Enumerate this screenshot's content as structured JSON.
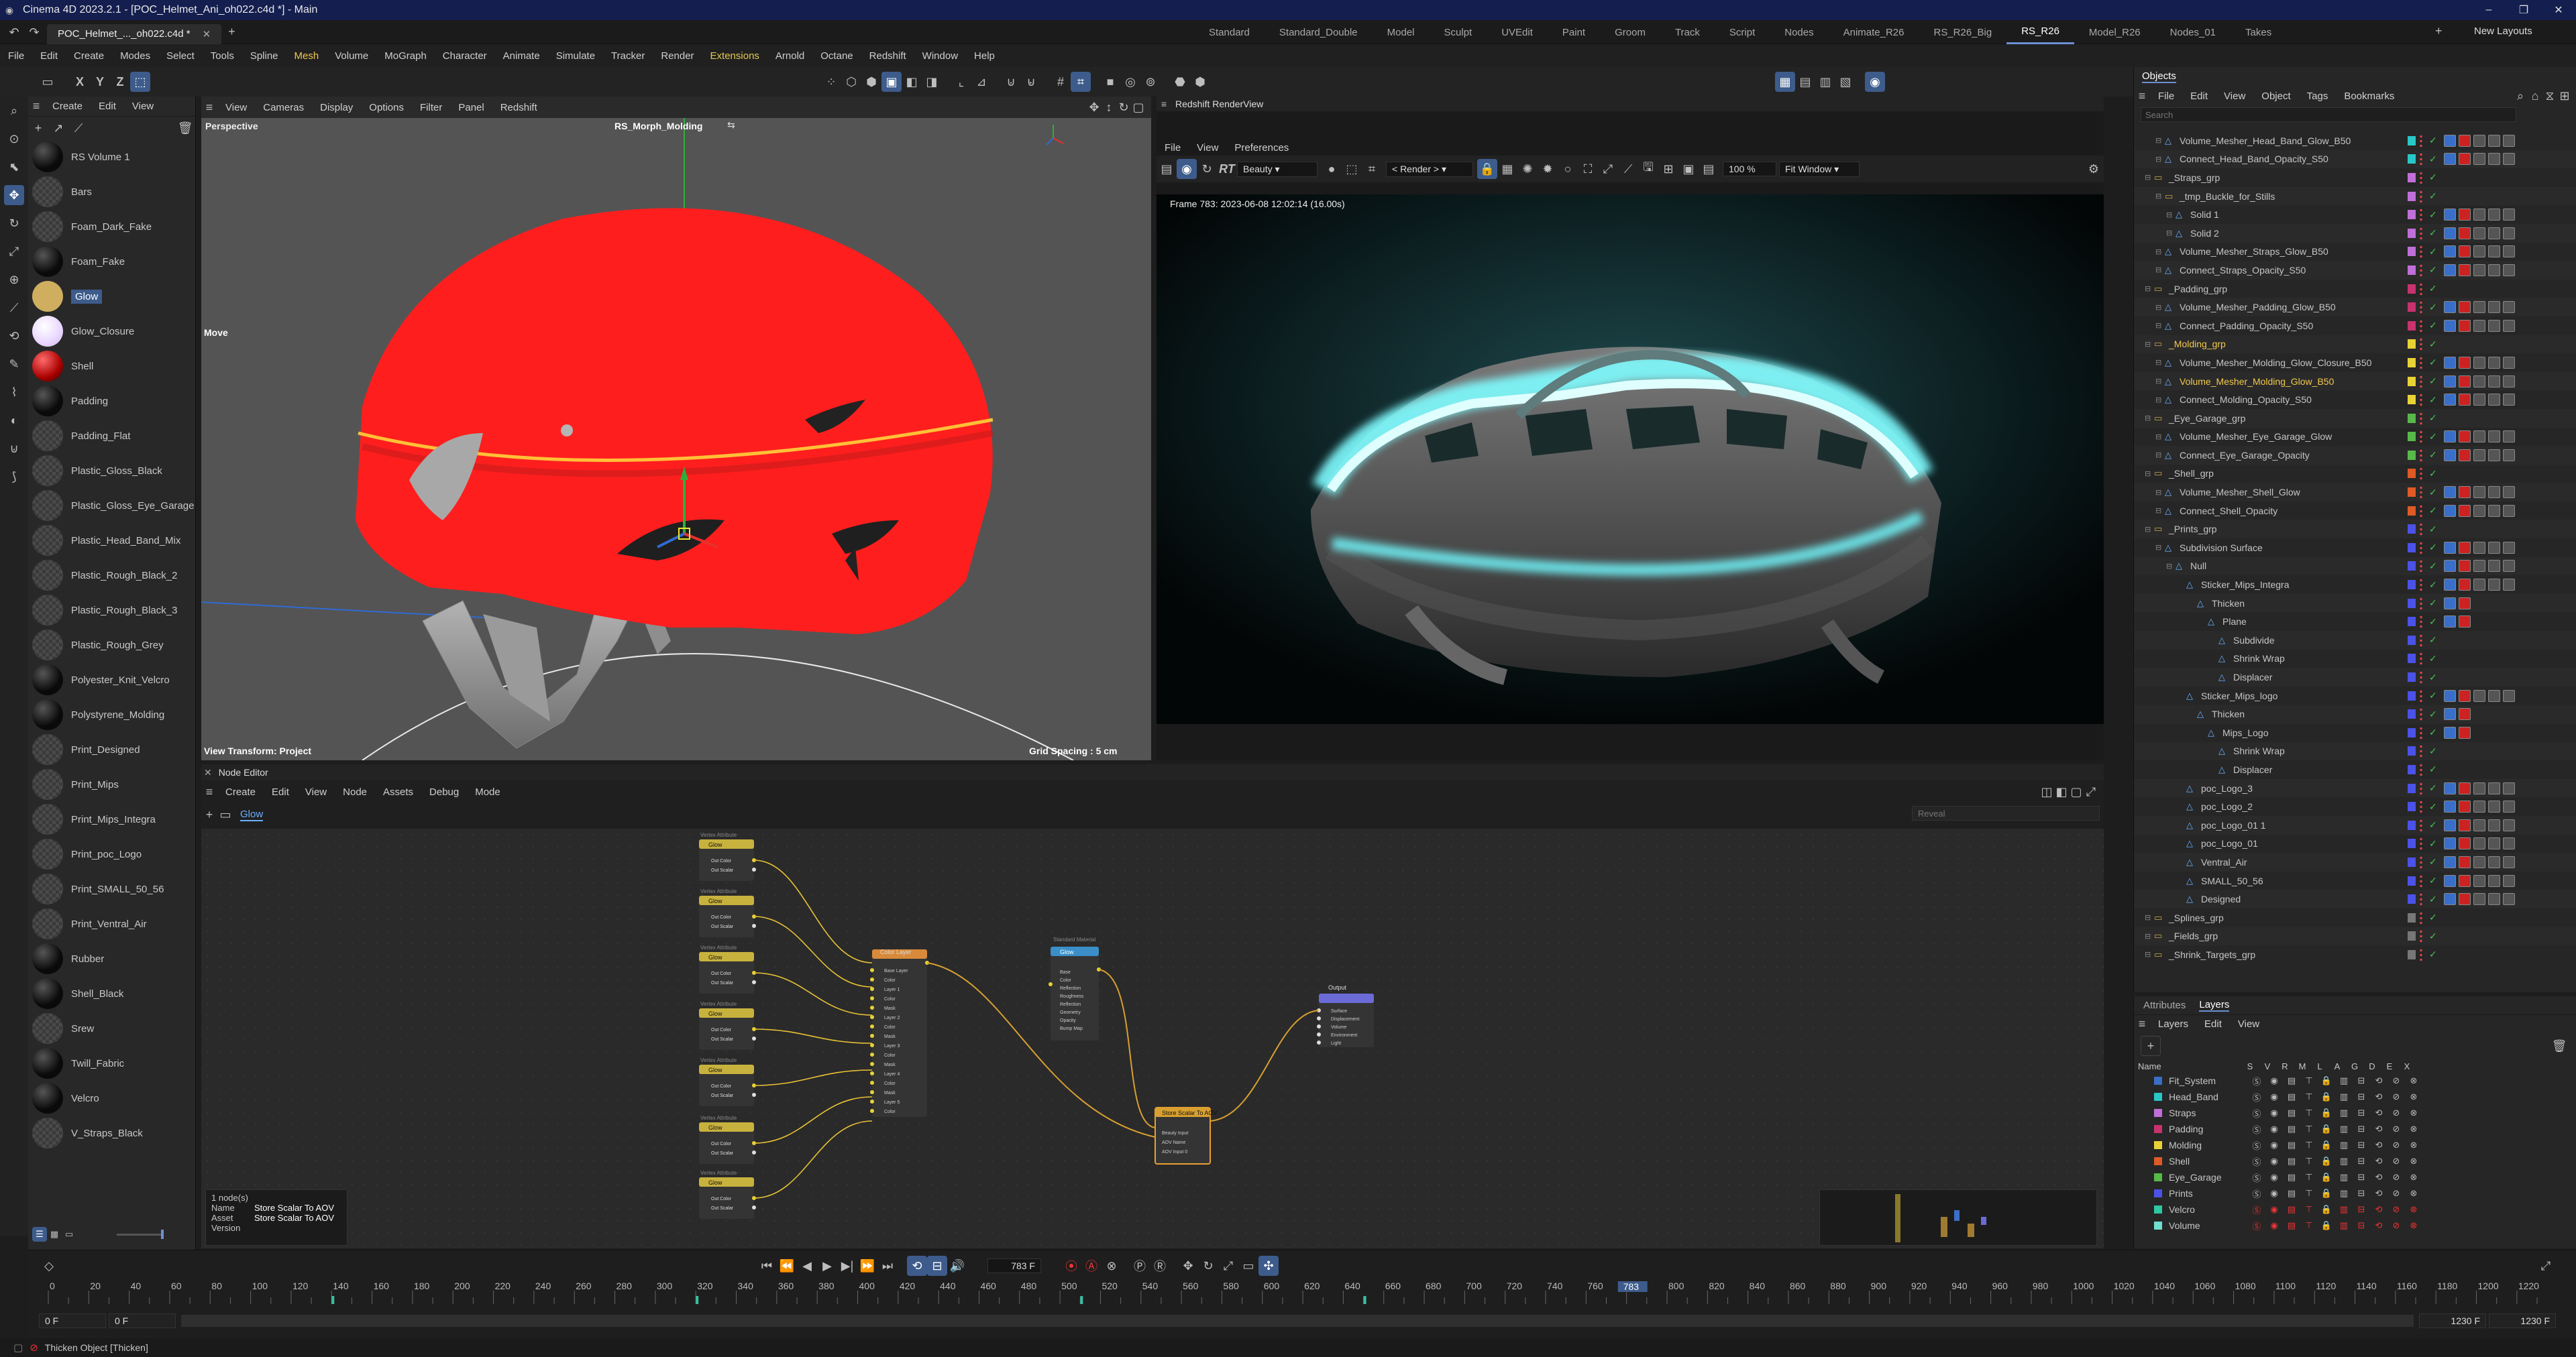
{
  "app": {
    "title": "Cinema 4D 2023.2.1 - [POC_Helmet_Ani_oh022.c4d *] - Main",
    "doc_tab": "POC_Helmet_..._oh022.c4d *",
    "new_tab": "+"
  },
  "window": {
    "min": "–",
    "max": "❐",
    "close": "✕"
  },
  "layouts": [
    "Standard",
    "Standard_Double",
    "Model",
    "Sculpt",
    "UVEdit",
    "Paint",
    "Groom",
    "Track",
    "Script",
    "Nodes",
    "Animate_R26",
    "RS_R26_Big",
    "RS_R26",
    "Model_R26",
    "Nodes_01",
    "Takes"
  ],
  "layouts_active": "RS_R26",
  "layouts_plus": "+",
  "new_layouts": "New Layouts",
  "menu": [
    "File",
    "Edit",
    "Create",
    "Modes",
    "Select",
    "Tools",
    "Spline",
    "Mesh",
    "Volume",
    "MoGraph",
    "Character",
    "Animate",
    "Simulate",
    "Tracker",
    "Render",
    "Extensions",
    "Arnold",
    "Octane",
    "Redshift",
    "Window",
    "Help"
  ],
  "toolbar": {
    "axes": [
      "X",
      "Y",
      "Z"
    ]
  },
  "materials": {
    "menu": [
      "Create",
      "Edit",
      "View"
    ],
    "items": [
      "RS Volume 1",
      "Bars",
      "Foam_Dark_Fake",
      "Foam_Fake",
      "Glow",
      "Glow_Closure",
      "Shell",
      "Padding",
      "Padding_Flat",
      "Plastic_Gloss_Black",
      "Plastic_Gloss_Eye_Garage",
      "Plastic_Head_Band_Mix",
      "Plastic_Rough_Black_2",
      "Plastic_Rough_Black_3",
      "Plastic_Rough_Grey",
      "Polyester_Knit_Velcro",
      "Polystyrene_Molding",
      "Print_Designed",
      "Print_Mips",
      "Print_Mips_Integra",
      "Print_poc_Logo",
      "Print_SMALL_50_56",
      "Print_Ventral_Air",
      "Rubber",
      "Shell_Black",
      "Srew",
      "Twill_Fabric",
      "Velcro",
      "V_Straps_Black"
    ],
    "selected": "Glow"
  },
  "viewport": {
    "menu": [
      "View",
      "Cameras",
      "Display",
      "Options",
      "Filter",
      "Panel",
      "Redshift"
    ],
    "name": "Perspective",
    "camera": "RS_Morph_Molding",
    "move": "Move",
    "view_transform": "View Transform: Project",
    "grid": "Grid Spacing : 5 cm"
  },
  "render": {
    "title": "Redshift RenderView",
    "menu": [
      "File",
      "View",
      "Preferences"
    ],
    "aov": "Beauty",
    "target": "< Render >",
    "zoom": "100 %",
    "fit": "Fit Window",
    "frame_info": "Frame  783:  2023-06-08  12:02:14  (16.00s)"
  },
  "node_editor": {
    "title": "Node Editor",
    "menu": [
      "Create",
      "Edit",
      "View",
      "Node",
      "Assets",
      "Debug",
      "Mode"
    ],
    "tab": "Glow",
    "search_placeholder": "Reveal",
    "nodes": {
      "vertex_title": "Vertex Attribute",
      "vertex_name": "Glow",
      "vertex_out": [
        "Out Color",
        "Out Scalar"
      ],
      "color_layer": "Color Layer",
      "color_layer_ports": [
        "Base Layer",
        "Color",
        "Layer 1",
        "Color",
        "Mask",
        "Layer 2",
        "Color",
        "Mask",
        "Layer 3",
        "Color",
        "Mask",
        "Layer 4",
        "Color",
        "Mask",
        "Layer 5",
        "Color"
      ],
      "std_mat_head": "Standard Material",
      "std_mat": "Glow",
      "std_ports": [
        "Base",
        "Color",
        "Reflection",
        "Roughness",
        "Reflection",
        "Geometry",
        "Opacity",
        "Bump Map"
      ],
      "store": "Store Scalar To AOV",
      "store_ports": [
        "Beauty Input",
        "AOV Name",
        "AOV Input 0"
      ],
      "output": "Output",
      "output_ports": [
        "Surface",
        "Displacement",
        "Volume",
        "Environment",
        "Light"
      ]
    },
    "info": {
      "count": "1 node(s)",
      "name_label": "Name",
      "name_value": "Store Scalar To AOV",
      "asset_label": "Asset",
      "asset_value": "Store Scalar To AOV",
      "version_label": "Version"
    }
  },
  "objects": {
    "tab": "Objects",
    "menu": [
      "File",
      "Edit",
      "View",
      "Object",
      "Tags",
      "Bookmarks"
    ],
    "search_placeholder": "Search",
    "items": [
      {
        "name": "Volume_Mesher_Head_Band_Glow_B50",
        "indent": 2,
        "color": "#29c7c7"
      },
      {
        "name": "Connect_Head_Band_Opacity_S50",
        "indent": 2,
        "color": "#29c7c7"
      },
      {
        "name": "_Straps_grp",
        "indent": 1,
        "color": "#c06fd8"
      },
      {
        "name": "_tmp_Buckle_for_Stills",
        "indent": 2,
        "color": "#c06fd8"
      },
      {
        "name": "Solid 1",
        "indent": 3,
        "color": "#c06fd8"
      },
      {
        "name": "Solid 2",
        "indent": 3,
        "color": "#c06fd8"
      },
      {
        "name": "Volume_Mesher_Straps_Glow_B50",
        "indent": 2,
        "color": "#c06fd8"
      },
      {
        "name": "Connect_Straps_Opacity_S50",
        "indent": 2,
        "color": "#c06fd8"
      },
      {
        "name": "_Padding_grp",
        "indent": 1,
        "color": "#c8326e"
      },
      {
        "name": "Volume_Mesher_Padding_Glow_B50",
        "indent": 2,
        "color": "#c8326e"
      },
      {
        "name": "Connect_Padding_Opacity_S50",
        "indent": 2,
        "color": "#c8326e"
      },
      {
        "name": "_Molding_grp",
        "indent": 1,
        "color": "#e8d235",
        "hl": true
      },
      {
        "name": "Volume_Mesher_Molding_Glow_Closure_B50",
        "indent": 2,
        "color": "#e8d235"
      },
      {
        "name": "Volume_Mesher_Molding_Glow_B50",
        "indent": 2,
        "color": "#e8d235",
        "hl": true
      },
      {
        "name": "Connect_Molding_Opacity_S50",
        "indent": 2,
        "color": "#e8d235"
      },
      {
        "name": "_Eye_Garage_grp",
        "indent": 1,
        "color": "#58b84a"
      },
      {
        "name": "Volume_Mesher_Eye_Garage_Glow",
        "indent": 2,
        "color": "#58b84a"
      },
      {
        "name": "Connect_Eye_Garage_Opacity",
        "indent": 2,
        "color": "#58b84a"
      },
      {
        "name": "_Shell_grp",
        "indent": 1,
        "color": "#e05a25"
      },
      {
        "name": "Volume_Mesher_Shell_Glow",
        "indent": 2,
        "color": "#e05a25"
      },
      {
        "name": "Connect_Shell_Opacity",
        "indent": 2,
        "color": "#e05a25"
      },
      {
        "name": "_Prints_grp",
        "indent": 1,
        "color": "#4b52e8"
      },
      {
        "name": "Subdivision Surface",
        "indent": 2,
        "color": "#4b52e8"
      },
      {
        "name": "Null",
        "indent": 3,
        "color": "#4b52e8"
      },
      {
        "name": "Sticker_Mips_Integra",
        "indent": 4,
        "color": "#4b52e8"
      },
      {
        "name": "Thicken",
        "indent": 5,
        "color": "#4b52e8"
      },
      {
        "name": "Plane",
        "indent": 6,
        "color": "#4b52e8"
      },
      {
        "name": "Subdivide",
        "indent": 7,
        "color": "#4b52e8"
      },
      {
        "name": "Shrink Wrap",
        "indent": 7,
        "color": "#4b52e8"
      },
      {
        "name": "Displacer",
        "indent": 7,
        "color": "#4b52e8"
      },
      {
        "name": "Sticker_Mips_logo",
        "indent": 4,
        "color": "#4b52e8"
      },
      {
        "name": "Thicken",
        "indent": 5,
        "color": "#4b52e8"
      },
      {
        "name": "Mips_Logo",
        "indent": 6,
        "color": "#4b52e8"
      },
      {
        "name": "Shrink Wrap",
        "indent": 7,
        "color": "#4b52e8"
      },
      {
        "name": "Displacer",
        "indent": 7,
        "color": "#4b52e8"
      },
      {
        "name": "poc_Logo_3",
        "indent": 4,
        "color": "#4b52e8"
      },
      {
        "name": "poc_Logo_2",
        "indent": 4,
        "color": "#4b52e8"
      },
      {
        "name": "poc_Logo_01 1",
        "indent": 4,
        "color": "#4b52e8"
      },
      {
        "name": "poc_Logo_01",
        "indent": 4,
        "color": "#4b52e8"
      },
      {
        "name": "Ventral_Air",
        "indent": 4,
        "color": "#4b52e8"
      },
      {
        "name": "SMALL_50_56",
        "indent": 4,
        "color": "#4b52e8"
      },
      {
        "name": "Designed",
        "indent": 4,
        "color": "#4b52e8"
      },
      {
        "name": "_Splines_grp",
        "indent": 1,
        "color": "#777777"
      },
      {
        "name": "_Fields_grp",
        "indent": 1,
        "color": "#777777"
      },
      {
        "name": "_Shrink_Targets_grp",
        "indent": 1,
        "color": "#777777"
      }
    ]
  },
  "layers": {
    "tabs": [
      "Attributes",
      "Layers"
    ],
    "active": "Layers",
    "menu": [
      "Layers",
      "Edit",
      "View"
    ],
    "name_header": "Name",
    "flags": [
      "S",
      "V",
      "R",
      "M",
      "L",
      "A",
      "G",
      "D",
      "E",
      "X"
    ],
    "items": [
      {
        "name": "Fit_System",
        "color": "#3a6fc9"
      },
      {
        "name": "Head_Band",
        "color": "#29c7c7"
      },
      {
        "name": "Straps",
        "color": "#c06fd8"
      },
      {
        "name": "Padding",
        "color": "#c8326e"
      },
      {
        "name": "Molding",
        "color": "#e8d235"
      },
      {
        "name": "Shell",
        "color": "#e05a25"
      },
      {
        "name": "Eye_Garage",
        "color": "#58b84a"
      },
      {
        "name": "Prints",
        "color": "#4b52e8"
      },
      {
        "name": "Velcro",
        "color": "#2dc9a0"
      },
      {
        "name": "Volume",
        "color": "#6ee0d0"
      }
    ]
  },
  "timeline": {
    "frame": "783 F",
    "start_a": "0 F",
    "start_b": "0 F",
    "end_a": "1230 F",
    "end_b": "1230 F",
    "current": "783",
    "ticks": [
      "0",
      "20",
      "40",
      "60",
      "80",
      "100",
      "120",
      "140",
      "160",
      "180",
      "200",
      "220",
      "240",
      "260",
      "280",
      "300",
      "320",
      "340",
      "360",
      "380",
      "400",
      "420",
      "440",
      "460",
      "480",
      "500",
      "520",
      "540",
      "560",
      "580",
      "600",
      "620",
      "640",
      "660",
      "680",
      "700",
      "720",
      "740",
      "760",
      "780",
      "800",
      "820",
      "840",
      "860",
      "880",
      "900",
      "920",
      "940",
      "960",
      "980",
      "1000",
      "1020",
      "1040",
      "1060",
      "1080",
      "1100",
      "1120",
      "1140",
      "1160",
      "1180",
      "1200",
      "1220"
    ]
  },
  "status": {
    "text": "Thicken Object [Thicken]"
  }
}
